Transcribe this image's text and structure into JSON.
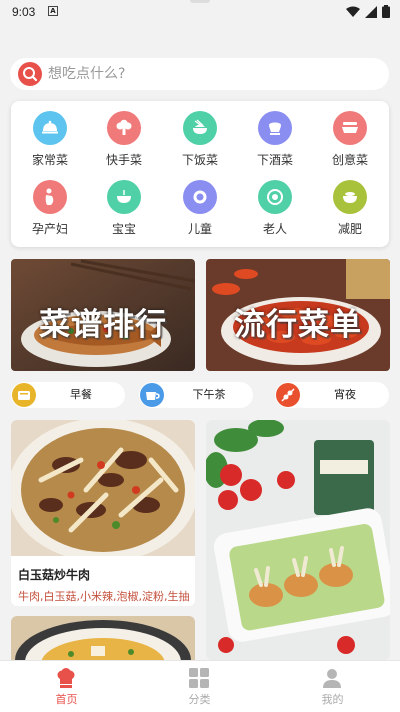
{
  "status_bar": {
    "time": "9:03",
    "badge": "A"
  },
  "search": {
    "placeholder": "想吃点什么?"
  },
  "categories": [
    {
      "label": "家常菜",
      "icon": "cloche-icon",
      "color": "#5cc4ee"
    },
    {
      "label": "快手菜",
      "icon": "broccoli-icon",
      "color": "#f07a7a"
    },
    {
      "label": "下饭菜",
      "icon": "rice-bowl-icon",
      "color": "#4fd0a6"
    },
    {
      "label": "下酒菜",
      "icon": "hotpot-icon",
      "color": "#8a8ef0"
    },
    {
      "label": "创意菜",
      "icon": "dish-icon",
      "color": "#f07a7a"
    },
    {
      "label": "孕产妇",
      "icon": "pregnant-icon",
      "color": "#f07a7a"
    },
    {
      "label": "宝宝",
      "icon": "baby-bowl-icon",
      "color": "#4fd0a6"
    },
    {
      "label": "儿童",
      "icon": "child-food-icon",
      "color": "#8a8ef0"
    },
    {
      "label": "老人",
      "icon": "noodle-bowl-icon",
      "color": "#4fd0a6"
    },
    {
      "label": "减肥",
      "icon": "salad-icon",
      "color": "#a8c23c"
    }
  ],
  "banners": [
    {
      "title": "菜谱排行"
    },
    {
      "title": "流行菜单"
    }
  ],
  "meals": [
    {
      "label": "早餐",
      "icon": "breakfast-icon",
      "color": "#e8b52a"
    },
    {
      "label": "下午茶",
      "icon": "tea-icon",
      "color": "#4a9ae8"
    },
    {
      "label": "宵夜",
      "icon": "skewer-icon",
      "color": "#e8502e"
    }
  ],
  "recipes": [
    {
      "title": "白玉菇炒牛肉",
      "ingredients": "牛肉,白玉菇,小米辣,泡椒,淀粉,生抽"
    }
  ],
  "tabs": [
    {
      "label": "首页",
      "active": true,
      "color": "#e8504a"
    },
    {
      "label": "分类",
      "active": false,
      "color": "#aaaaaa"
    },
    {
      "label": "我的",
      "active": false,
      "color": "#aaaaaa"
    }
  ]
}
